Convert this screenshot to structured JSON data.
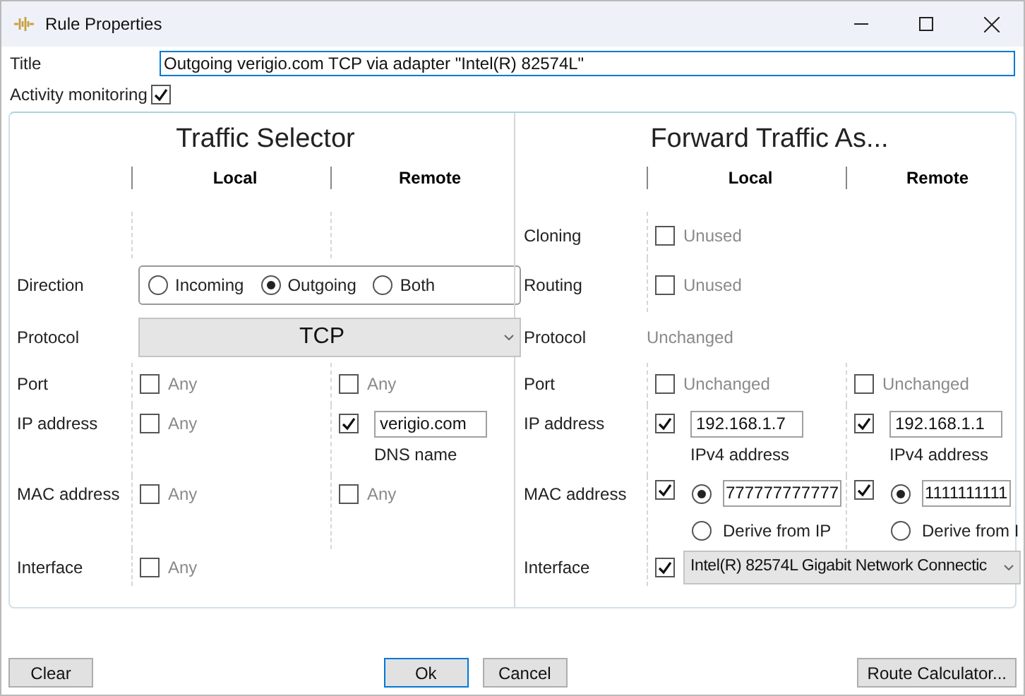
{
  "window": {
    "title": "Rule Properties"
  },
  "title_field": {
    "label": "Title",
    "value": "Outgoing verigio.com TCP via adapter \"Intel(R) 82574L\""
  },
  "activity_monitoring": {
    "label": "Activity monitoring",
    "checked": true
  },
  "traffic_selector": {
    "heading": "Traffic Selector",
    "columns": [
      "Local",
      "Remote"
    ],
    "direction": {
      "label": "Direction",
      "options": [
        {
          "label": "Incoming",
          "selected": false
        },
        {
          "label": "Outgoing",
          "selected": true
        },
        {
          "label": "Both",
          "selected": false
        }
      ]
    },
    "protocol": {
      "label": "Protocol",
      "value": "TCP"
    },
    "port": {
      "label": "Port",
      "local": {
        "kind": "check",
        "checked": false,
        "text": "Any"
      },
      "remote": {
        "kind": "check",
        "checked": false,
        "text": "Any"
      }
    },
    "ip_address": {
      "label": "IP address",
      "local": {
        "kind": "check",
        "checked": false,
        "text": "Any"
      },
      "remote": {
        "kind": "field",
        "checked": true,
        "value": "verigio.com",
        "caption": "DNS name"
      }
    },
    "mac_address": {
      "label": "MAC address",
      "local": {
        "kind": "check",
        "checked": false,
        "text": "Any"
      },
      "remote": {
        "kind": "check",
        "checked": false,
        "text": "Any"
      }
    },
    "interface": {
      "label": "Interface",
      "local": {
        "kind": "check",
        "checked": false,
        "text": "Any"
      }
    }
  },
  "forward_traffic": {
    "heading": "Forward Traffic As...",
    "columns": [
      "Local",
      "Remote"
    ],
    "cloning": {
      "label": "Cloning",
      "local": {
        "kind": "check",
        "checked": false,
        "text": "Unused"
      }
    },
    "routing": {
      "label": "Routing",
      "local": {
        "kind": "check",
        "checked": false,
        "text": "Unused"
      }
    },
    "protocol": {
      "label": "Protocol",
      "value": "Unchanged"
    },
    "port": {
      "label": "Port",
      "local": {
        "kind": "check",
        "checked": false,
        "text": "Unchanged"
      },
      "remote": {
        "kind": "check",
        "checked": false,
        "text": "Unchanged"
      }
    },
    "ip_address": {
      "label": "IP address",
      "local": {
        "kind": "field",
        "checked": true,
        "value": "192.168.1.7",
        "caption": "IPv4 address"
      },
      "remote": {
        "kind": "field",
        "checked": true,
        "value": "192.168.1.1",
        "caption": "IPv4 address"
      }
    },
    "mac_address": {
      "label": "MAC address",
      "local": {
        "kind": "mac",
        "checked": true,
        "options": [
          {
            "kind": "field",
            "selected": true,
            "value": "777777777777"
          },
          {
            "kind": "text",
            "selected": false,
            "label": "Derive from IP"
          }
        ]
      },
      "remote": {
        "kind": "mac",
        "checked": true,
        "options": [
          {
            "kind": "field",
            "selected": true,
            "value": "1111111111"
          },
          {
            "kind": "text",
            "selected": false,
            "label": "Derive from I"
          }
        ]
      }
    },
    "interface": {
      "label": "Interface",
      "checked": true,
      "value": "Intel(R) 82574L Gigabit Network Connectic"
    }
  },
  "buttons": [
    {
      "label": "Clear",
      "default": false
    },
    {
      "label": "Ok",
      "default": true
    },
    {
      "label": "Cancel",
      "default": false
    },
    {
      "label": "Route Calculator...",
      "default": false
    }
  ]
}
